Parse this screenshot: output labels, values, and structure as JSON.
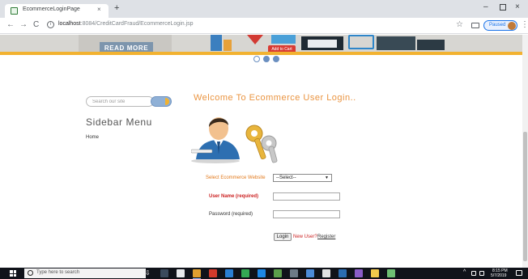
{
  "browser": {
    "tab_title": "EcommerceLoginPage",
    "tab_close": "×",
    "new_tab": "+",
    "window_controls": {
      "minimize": "–",
      "close": "×"
    },
    "nav": {
      "back": "←",
      "forward": "→",
      "reload": "C"
    },
    "url_host": "localhost",
    "url_rest": ":8084/CreditCardFraud/EcommerceLogin.jsp",
    "bookmark_icon": "☆",
    "profile_label": "Paused",
    "menu": "⋮"
  },
  "banner": {
    "read_more_label": "READ MORE",
    "cart_tag_label": "Add to Cart",
    "slide_dots": 3
  },
  "sidebar": {
    "search_placeholder": "Search our site",
    "title": "Sidebar Menu",
    "items": [
      {
        "label": "Home"
      }
    ]
  },
  "main": {
    "heading": "Welcome To Ecommerce User Login..",
    "illustration_icon": "user-with-keys-icon",
    "website_label": "Select Ecommerce Website",
    "website_selected": "--Select--",
    "username_label": "User Name (required)",
    "username_value": "",
    "password_label": "Password (required)",
    "password_value": "",
    "login_button": "Login",
    "new_user_text": "New User?",
    "register_link": "Register"
  },
  "taskbar": {
    "search_placeholder": "Type here to search",
    "time": "8:15 PM",
    "date": "5/7/2019"
  },
  "colors": {
    "heading": "#ea9440",
    "required_label": "#cc2222",
    "select_label": "#e2791b",
    "banner_strip": "#f2b230",
    "read_more_button": "#7d95ad",
    "taskbar": "#10131a"
  }
}
